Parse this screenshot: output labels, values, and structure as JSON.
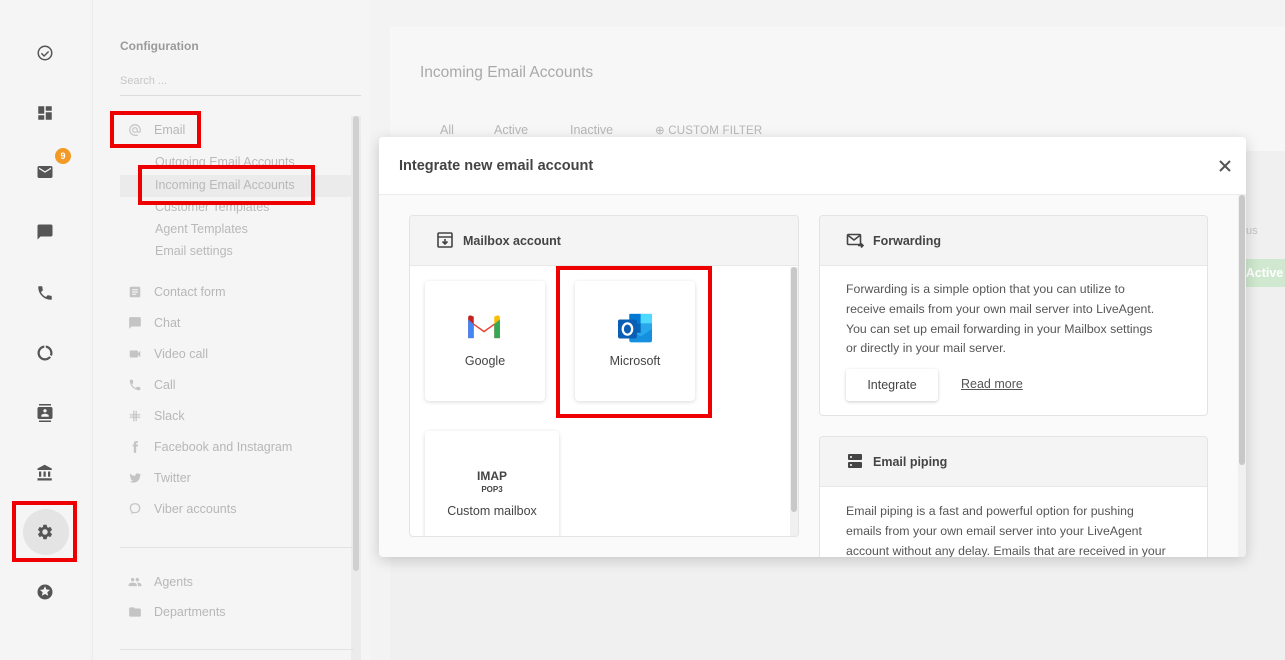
{
  "rail": {
    "mail_badge": "9"
  },
  "config": {
    "title": "Configuration",
    "search_placeholder": "Search ...",
    "email_group": "Email",
    "email_items": [
      "Outgoing Email Accounts",
      "Incoming Email Accounts",
      "Customer Templates",
      "Agent Templates",
      "Email settings"
    ],
    "channels": [
      "Contact form",
      "Chat",
      "Video call",
      "Call",
      "Slack",
      "Facebook and Instagram",
      "Twitter",
      "Viber accounts"
    ],
    "people": [
      "Agents",
      "Departments"
    ]
  },
  "main": {
    "title": "Incoming Email Accounts",
    "tabs": [
      "All",
      "Active",
      "Inactive",
      "CUSTOM FILTER"
    ],
    "status_label": "tus",
    "status_value": "Active"
  },
  "modal": {
    "title": "Integrate new email account",
    "mailbox": {
      "title": "Mailbox account",
      "google_label": "Google",
      "microsoft_label": "Microsoft",
      "imap_label": "IMAP",
      "pop3_label": "POP3",
      "custom_label": "Custom mailbox"
    },
    "forwarding": {
      "title": "Forwarding",
      "lines": [
        "Forwarding is a simple option that you can utilize to",
        "receive emails from your own mail server into LiveAgent.",
        "You can set up email forwarding in your Mailbox settings",
        "or directly in your mail server."
      ],
      "integrate_label": "Integrate",
      "read_more_label": "Read more"
    },
    "piping": {
      "title": "Email piping",
      "lines": [
        "Email piping is a fast and powerful option for pushing",
        "emails from your own email server into your LiveAgent",
        "account without any delay. Emails that are received in your"
      ]
    }
  },
  "colors": {
    "annotation": "#ee0000",
    "badge": "#f29a25",
    "active_pill": "#cfe8cf"
  }
}
